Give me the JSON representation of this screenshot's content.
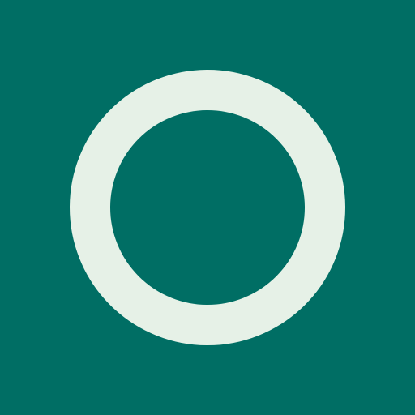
{
  "icon": {
    "name": "ring-icon",
    "colors": {
      "background": "#006e64",
      "ring": "#e6f1e7"
    }
  }
}
